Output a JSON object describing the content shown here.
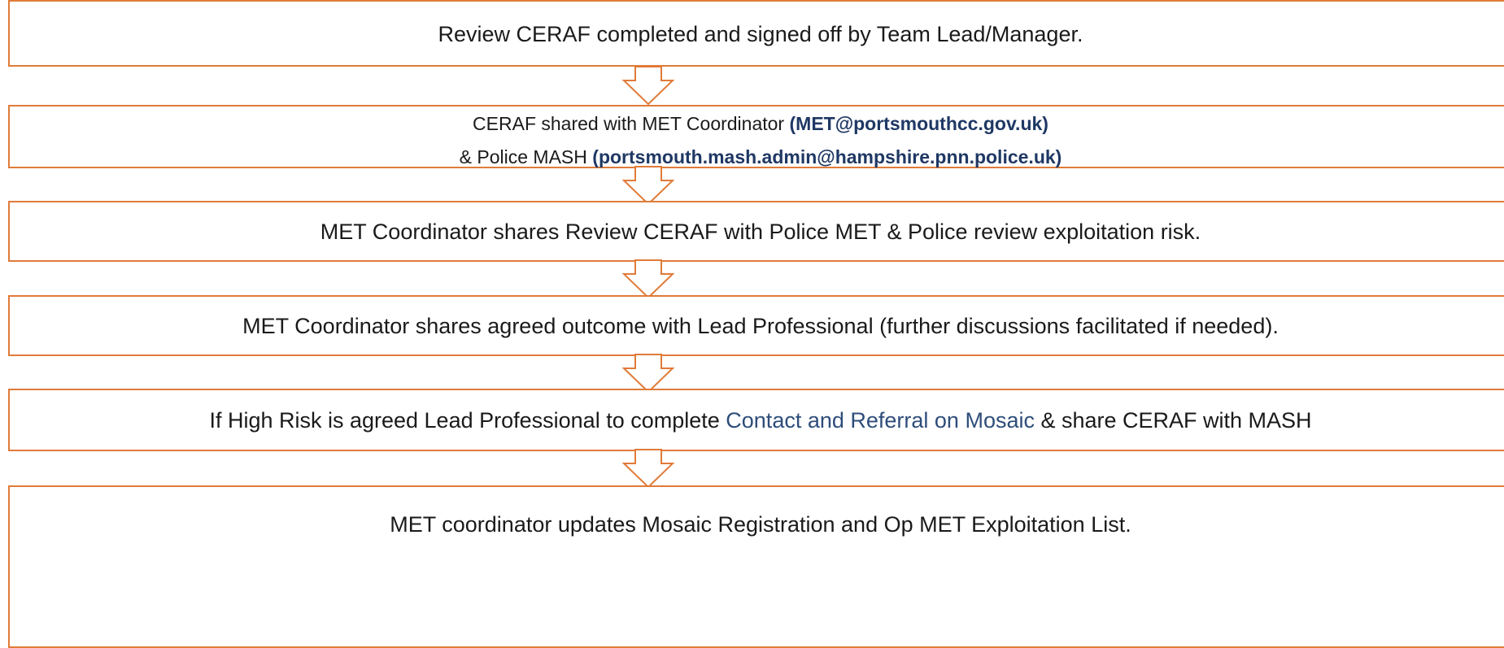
{
  "flowchart": {
    "border_color": "#E07B39",
    "arrow_color": "#E07B39",
    "steps": [
      {
        "text": "Review CERAF completed and signed off by Team Lead/Manager."
      },
      {
        "line1_prefix": "CERAF shared with MET Coordinator ",
        "line1_email": "(MET@portsmouthcc.gov.uk)",
        "line2_prefix": "& Police MASH ",
        "line2_email": "(portsmouth.mash.admin@hampshire.pnn.police.uk)"
      },
      {
        "text": "MET Coordinator shares Review CERAF with Police MET & Police review exploitation risk."
      },
      {
        "text": "MET Coordinator shares agreed outcome with Lead Professional (further discussions facilitated if needed)."
      },
      {
        "prefix": "If High Risk is agreed Lead Professional to complete ",
        "link": "Contact and Referral on Mosaic",
        "suffix": " & share CERAF with MASH"
      },
      {
        "text": "MET coordinator updates Mosaic Registration and Op MET Exploitation List."
      }
    ]
  }
}
